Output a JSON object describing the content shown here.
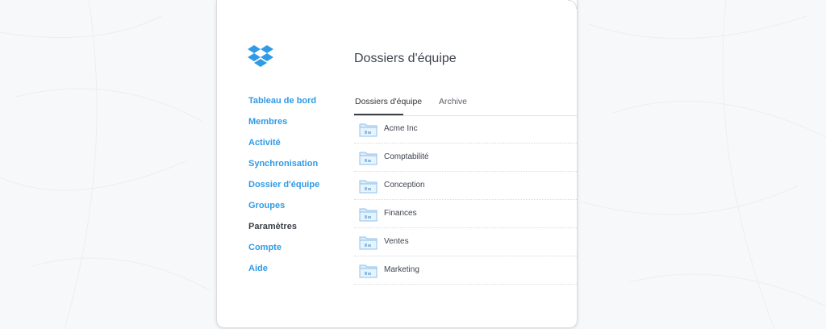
{
  "brand": {
    "logo_icon": "dropbox-logo-icon",
    "accent_color": "#2f9be6"
  },
  "sidebar": {
    "items": [
      {
        "label": "Tableau de bord",
        "active": false
      },
      {
        "label": "Membres",
        "active": false
      },
      {
        "label": "Activité",
        "active": false
      },
      {
        "label": "Synchronisation",
        "active": false
      },
      {
        "label": "Dossier d'équipe",
        "active": false
      },
      {
        "label": "Groupes",
        "active": false
      },
      {
        "label": "Paramètres",
        "active": true
      },
      {
        "label": "Compte",
        "active": false
      },
      {
        "label": "Aide",
        "active": false
      }
    ]
  },
  "main": {
    "title": "Dossiers d'équipe",
    "tabs": [
      {
        "label": "Dossiers d'équipe",
        "selected": true
      },
      {
        "label": "Archive",
        "selected": false
      }
    ],
    "folders": [
      {
        "name": "Acme Inc",
        "icon": "team-folder-icon"
      },
      {
        "name": "Comptabilité",
        "icon": "team-folder-icon"
      },
      {
        "name": "Conception",
        "icon": "team-folder-icon"
      },
      {
        "name": "Finances",
        "icon": "team-folder-icon"
      },
      {
        "name": "Ventes",
        "icon": "team-folder-icon"
      },
      {
        "name": "Marketing",
        "icon": "team-folder-icon"
      }
    ]
  }
}
